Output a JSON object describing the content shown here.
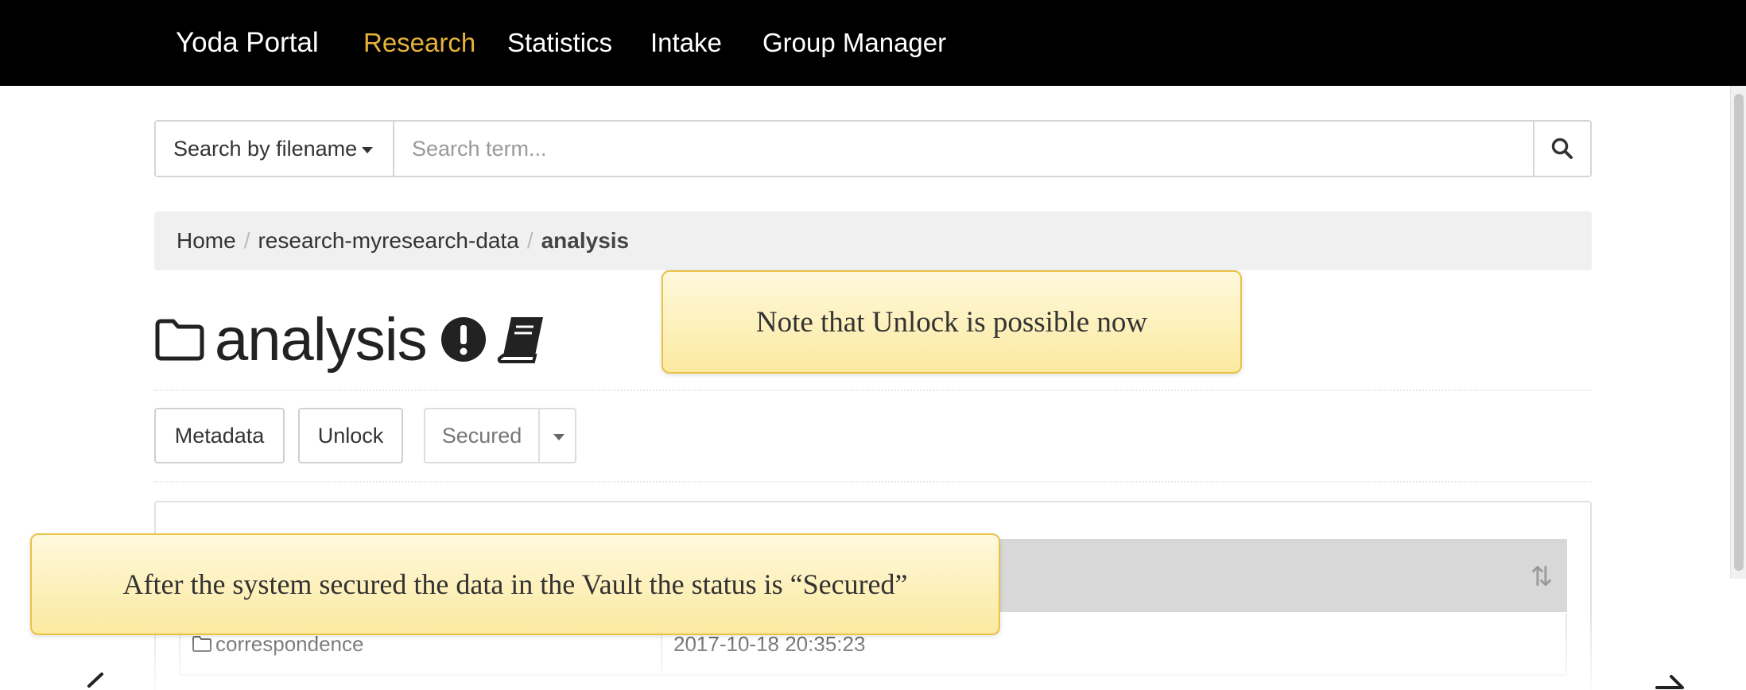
{
  "navbar": {
    "brand": "Yoda Portal",
    "items": [
      {
        "label": "Research",
        "active": true
      },
      {
        "label": "Statistics",
        "active": false
      },
      {
        "label": "Intake",
        "active": false
      },
      {
        "label": "Group Manager",
        "active": false
      }
    ]
  },
  "search": {
    "type_label": "Search by filename",
    "placeholder": "Search term..."
  },
  "breadcrumb": {
    "items": [
      "Home",
      "research-myresearch-data",
      "analysis"
    ],
    "separator": "/"
  },
  "folder": {
    "title": "analysis"
  },
  "actions": {
    "metadata_label": "Metadata",
    "unlock_label": "Unlock",
    "status_label": "Secured"
  },
  "table": {
    "rows": [
      {
        "name": "correspondence",
        "date": "2017-10-18 20:35:23"
      }
    ]
  },
  "callouts": {
    "unlock_note": "Note that Unlock is possible now",
    "secured_note": "After the system secured the data in the Vault the status is “Secured”"
  },
  "colors": {
    "navbar_bg": "#000000",
    "nav_active": "#e6b33a",
    "callout_border": "#e9c247",
    "callout_fill": "#fbe9a0"
  }
}
